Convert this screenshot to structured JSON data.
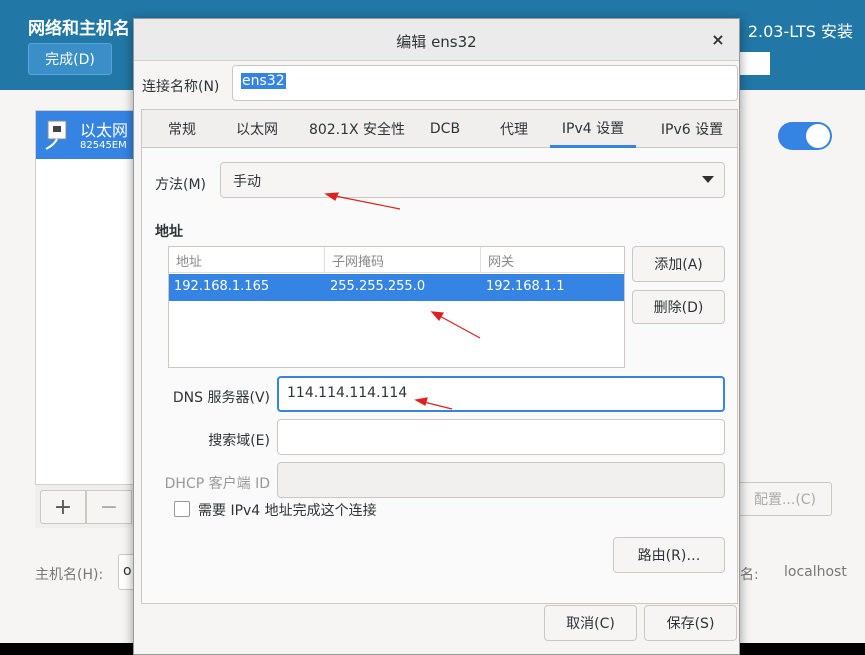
{
  "background": {
    "title": "网络和主机名",
    "right_title": "2.03-LTS 安装",
    "done_button": "完成(D)",
    "list_item_name": "以太网",
    "list_item_sub": "82545EM",
    "plus": "+",
    "minus": "−",
    "config_button": "配置...(C)",
    "hostname_label": "主机名(H):",
    "hostname_value": "o",
    "right_label": "名:",
    "right_value": "localhost"
  },
  "dialog": {
    "title": "编辑 ens32",
    "close": "×",
    "connection_name_label": "连接名称(N)",
    "connection_name_value": "ens32",
    "tabs": [
      {
        "label": "常规"
      },
      {
        "label": "以太网"
      },
      {
        "label": "802.1X 安全性"
      },
      {
        "label": "DCB"
      },
      {
        "label": "代理"
      },
      {
        "label": "IPv4 设置"
      },
      {
        "label": "IPv6 设置"
      }
    ],
    "active_tab": "IPv4 设置",
    "method_label": "方法(M)",
    "method_value": "手动",
    "addresses_heading": "地址",
    "address_columns": [
      "地址",
      "子网掩码",
      "网关"
    ],
    "address_rows": [
      [
        "192.168.1.165",
        "255.255.255.0",
        "192.168.1.1"
      ]
    ],
    "add_button": "添加(A)",
    "delete_button": "删除(D)",
    "dns_label": "DNS 服务器(V)",
    "dns_value": "114.114.114.114",
    "search_label": "搜索域(E)",
    "search_value": "",
    "dhcp_label": "DHCP 客户端 ID",
    "dhcp_value": "",
    "require_ipv4_label": "需要 IPv4 地址完成这个连接",
    "require_ipv4_checked": false,
    "routes_button": "路由(R)…",
    "cancel_button": "取消(C)",
    "save_button": "保存(S)"
  },
  "colors": {
    "accent": "#3584e4",
    "header": "#2177a5",
    "annotation": "#e02020"
  }
}
